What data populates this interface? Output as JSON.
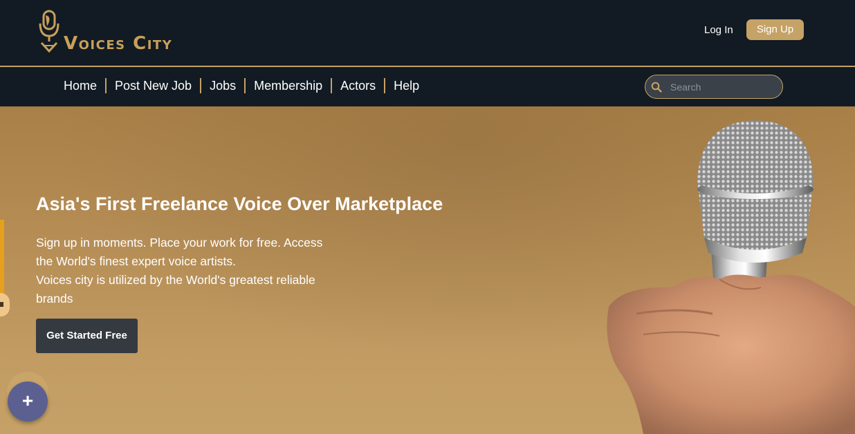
{
  "brand": {
    "name": "Voices City"
  },
  "header": {
    "login_label": "Log In",
    "signup_label": "Sign Up"
  },
  "nav": {
    "items": [
      {
        "label": "Home"
      },
      {
        "label": "Post New Job"
      },
      {
        "label": "Jobs"
      },
      {
        "label": "Membership"
      },
      {
        "label": "Actors"
      },
      {
        "label": "Help"
      }
    ]
  },
  "search": {
    "placeholder": "Search",
    "value": ""
  },
  "hero": {
    "title": "Asia's First Freelance Voice Over Marketplace",
    "description_lines": [
      "Sign up in moments. Place your work for free. Access the World's finest expert voice artists.",
      "Voices city is utilized by the World's greatest reliable brands"
    ],
    "cta_label": "Get Started Free"
  },
  "fab": {
    "icon": "plus-icon",
    "label": "+"
  },
  "colors": {
    "header_bg": "#121b23",
    "accent_gold": "#c5a266",
    "hero_bg": "#b58d55",
    "cta_bg": "#353a40",
    "fab_bg": "#5c6091"
  }
}
